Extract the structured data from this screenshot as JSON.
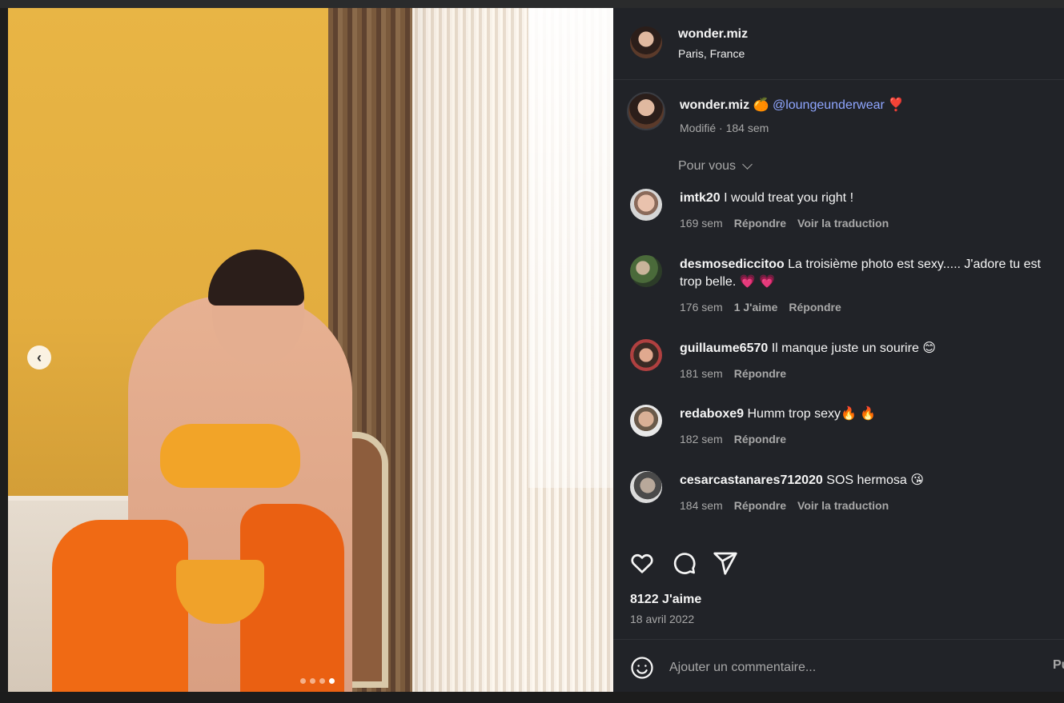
{
  "post": {
    "username": "wonder.miz",
    "location": "Paris, France"
  },
  "caption": {
    "username": "wonder.miz",
    "emoji1": "🍊",
    "mention": "@loungeunderwear",
    "emoji2": "❣️",
    "meta": "Modifié · 184 sem"
  },
  "sort_label": "Pour vous",
  "comments": [
    {
      "username": "imtk20",
      "text": "I would treat you right !",
      "time": "169 sem",
      "likes": "",
      "reply": "Répondre",
      "translate": "Voir la traduction"
    },
    {
      "username": "desmosediccitoo",
      "text": "La troisième photo est sexy..... J'adore tu est trop belle. 💗 💗",
      "time": "176 sem",
      "likes": "1 J'aime",
      "reply": "Répondre",
      "translate": ""
    },
    {
      "username": "guillaume6570",
      "text": "Il manque juste un sourire 😊",
      "time": "181 sem",
      "likes": "",
      "reply": "Répondre",
      "translate": ""
    },
    {
      "username": "redaboxe9",
      "text": "Humm trop sexy🔥 🔥",
      "time": "182 sem",
      "likes": "",
      "reply": "Répondre",
      "translate": ""
    },
    {
      "username": "cesarcastanares712020",
      "text": "SOS hermosa 😘",
      "time": "184 sem",
      "likes": "",
      "reply": "Répondre",
      "translate": "Voir la traduction"
    }
  ],
  "like_count": "8122 J'aime",
  "date": "18 avril 2022",
  "comment_input": {
    "placeholder": "Ajouter un commentaire...",
    "value": ""
  },
  "post_button": "Pu",
  "carousel": {
    "total": 4,
    "current": 4
  },
  "icons": [
    "chevron-left-icon",
    "heart-icon",
    "comment-icon",
    "share-icon",
    "emoji-icon"
  ],
  "colors": {
    "panel_bg": "#212328",
    "mention": "#8fa6ff",
    "meta": "#a8a8a8"
  }
}
